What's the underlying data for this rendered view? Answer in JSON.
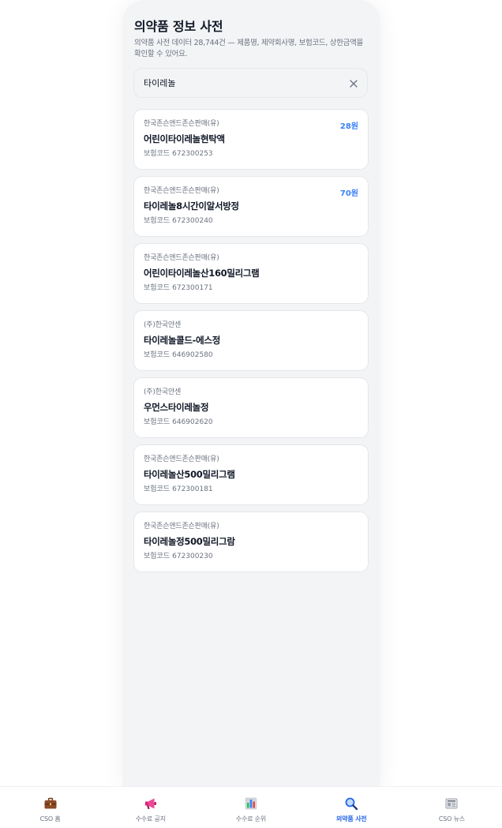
{
  "header": {
    "title": "의약품 정보 사전",
    "description": "의약품 사전 데이터 28,744건 — 제품명, 제약회사명, 보험코드, 상한금액을 확인할 수 있어요."
  },
  "search": {
    "value": "타이레놀",
    "clear_icon": "close-icon"
  },
  "results": {
    "code_label": "보험코드",
    "items": [
      {
        "maker": "한국존슨앤드존슨판매(유)",
        "name": "어린이타이레놀현탁액",
        "code": "672300253",
        "price": "28원"
      },
      {
        "maker": "한국존슨앤드존슨판매(유)",
        "name": "타이레놀8시간이알서방정",
        "code": "672300240",
        "price": "70원"
      },
      {
        "maker": "한국존슨앤드존슨판매(유)",
        "name": "어린이타이레놀산160밀리그램",
        "code": "672300171",
        "price": ""
      },
      {
        "maker": "(주)한국얀센",
        "name": "타이레놀콜드-에스정",
        "code": "646902580",
        "price": ""
      },
      {
        "maker": "(주)한국얀센",
        "name": "우먼스타이레놀정",
        "code": "646902620",
        "price": ""
      },
      {
        "maker": "한국존슨앤드존슨판매(유)",
        "name": "타이레놀산500밀리그램",
        "code": "672300181",
        "price": ""
      },
      {
        "maker": "한국존슨앤드존슨판매(유)",
        "name": "타이레놀정500밀리그람",
        "code": "672300230",
        "price": ""
      }
    ]
  },
  "nav": {
    "items": [
      {
        "label": "CSO 홈",
        "icon": "briefcase-icon"
      },
      {
        "label": "수수료 공지",
        "icon": "megaphone-icon"
      },
      {
        "label": "수수료 순위",
        "icon": "bar-chart-icon"
      },
      {
        "label": "의약품 사전",
        "icon": "magnifier-icon",
        "active": true
      },
      {
        "label": "CSO 뉴스",
        "icon": "newspaper-icon"
      }
    ],
    "active_color": "#2563eb"
  },
  "colors": {
    "accent": "#3b82f6",
    "page_bg": "#f3f4f6",
    "card_bg": "#ffffff"
  }
}
